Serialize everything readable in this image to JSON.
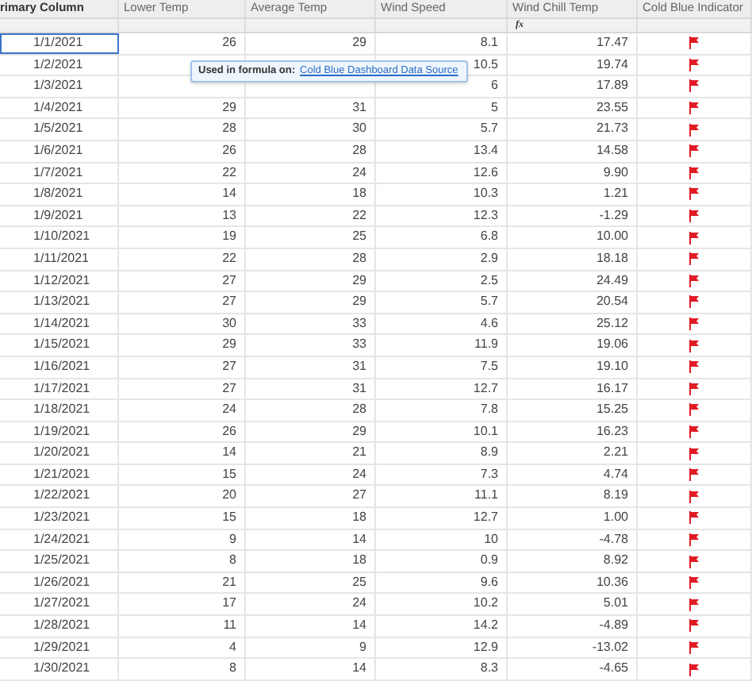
{
  "table": {
    "columns": [
      {
        "label": "rimary Column"
      },
      {
        "label": "Lower Temp"
      },
      {
        "label": "Average Temp"
      },
      {
        "label": "Wind Speed"
      },
      {
        "label": "Wind Chill Temp",
        "formula_mark": "fx"
      },
      {
        "label": "Cold Blue Indicator"
      }
    ],
    "rows": [
      {
        "date": "1/1/2021",
        "lower_temp": "26",
        "average_temp": "29",
        "wind_speed": "8.1",
        "wind_chill": "17.47",
        "flagged": true,
        "selected": true
      },
      {
        "date": "1/2/2021",
        "wind_speed": "10.5",
        "wind_chill": "19.74",
        "flagged": true,
        "selected": false
      },
      {
        "date": "1/3/2021",
        "wind_speed": "6",
        "wind_chill": "17.89",
        "flagged": true,
        "selected": false
      },
      {
        "date": "1/4/2021",
        "lower_temp": "29",
        "average_temp": "31",
        "wind_speed": "5",
        "wind_chill": "23.55",
        "flagged": true,
        "selected": false
      },
      {
        "date": "1/5/2021",
        "lower_temp": "28",
        "average_temp": "30",
        "wind_speed": "5.7",
        "wind_chill": "21.73",
        "flagged": true,
        "selected": false
      },
      {
        "date": "1/6/2021",
        "lower_temp": "26",
        "average_temp": "28",
        "wind_speed": "13.4",
        "wind_chill": "14.58",
        "flagged": true,
        "selected": false
      },
      {
        "date": "1/7/2021",
        "lower_temp": "22",
        "average_temp": "24",
        "wind_speed": "12.6",
        "wind_chill": "9.90",
        "flagged": true,
        "selected": false
      },
      {
        "date": "1/8/2021",
        "lower_temp": "14",
        "average_temp": "18",
        "wind_speed": "10.3",
        "wind_chill": "1.21",
        "flagged": true,
        "selected": false
      },
      {
        "date": "1/9/2021",
        "lower_temp": "13",
        "average_temp": "22",
        "wind_speed": "12.3",
        "wind_chill": "-1.29",
        "flagged": true,
        "selected": false
      },
      {
        "date": "1/10/2021",
        "lower_temp": "19",
        "average_temp": "25",
        "wind_speed": "6.8",
        "wind_chill": "10.00",
        "flagged": true,
        "selected": false
      },
      {
        "date": "1/11/2021",
        "lower_temp": "22",
        "average_temp": "28",
        "wind_speed": "2.9",
        "wind_chill": "18.18",
        "flagged": true,
        "selected": false
      },
      {
        "date": "1/12/2021",
        "lower_temp": "27",
        "average_temp": "29",
        "wind_speed": "2.5",
        "wind_chill": "24.49",
        "flagged": true,
        "selected": false
      },
      {
        "date": "1/13/2021",
        "lower_temp": "27",
        "average_temp": "29",
        "wind_speed": "5.7",
        "wind_chill": "20.54",
        "flagged": true,
        "selected": false
      },
      {
        "date": "1/14/2021",
        "lower_temp": "30",
        "average_temp": "33",
        "wind_speed": "4.6",
        "wind_chill": "25.12",
        "flagged": true,
        "selected": false
      },
      {
        "date": "1/15/2021",
        "lower_temp": "29",
        "average_temp": "33",
        "wind_speed": "11.9",
        "wind_chill": "19.06",
        "flagged": true,
        "selected": false
      },
      {
        "date": "1/16/2021",
        "lower_temp": "27",
        "average_temp": "31",
        "wind_speed": "7.5",
        "wind_chill": "19.10",
        "flagged": true,
        "selected": false
      },
      {
        "date": "1/17/2021",
        "lower_temp": "27",
        "average_temp": "31",
        "wind_speed": "12.7",
        "wind_chill": "16.17",
        "flagged": true,
        "selected": false
      },
      {
        "date": "1/18/2021",
        "lower_temp": "24",
        "average_temp": "28",
        "wind_speed": "7.8",
        "wind_chill": "15.25",
        "flagged": true,
        "selected": false
      },
      {
        "date": "1/19/2021",
        "lower_temp": "26",
        "average_temp": "29",
        "wind_speed": "10.1",
        "wind_chill": "16.23",
        "flagged": true,
        "selected": false
      },
      {
        "date": "1/20/2021",
        "lower_temp": "14",
        "average_temp": "21",
        "wind_speed": "8.9",
        "wind_chill": "2.21",
        "flagged": true,
        "selected": false
      },
      {
        "date": "1/21/2021",
        "lower_temp": "15",
        "average_temp": "24",
        "wind_speed": "7.3",
        "wind_chill": "4.74",
        "flagged": true,
        "selected": false
      },
      {
        "date": "1/22/2021",
        "lower_temp": "20",
        "average_temp": "27",
        "wind_speed": "11.1",
        "wind_chill": "8.19",
        "flagged": true,
        "selected": false
      },
      {
        "date": "1/23/2021",
        "lower_temp": "15",
        "average_temp": "18",
        "wind_speed": "12.7",
        "wind_chill": "1.00",
        "flagged": true,
        "selected": false
      },
      {
        "date": "1/24/2021",
        "lower_temp": "9",
        "average_temp": "14",
        "wind_speed": "10",
        "wind_chill": "-4.78",
        "flagged": true,
        "selected": false
      },
      {
        "date": "1/25/2021",
        "lower_temp": "8",
        "average_temp": "18",
        "wind_speed": "0.9",
        "wind_chill": "8.92",
        "flagged": true,
        "selected": false
      },
      {
        "date": "1/26/2021",
        "lower_temp": "21",
        "average_temp": "25",
        "wind_speed": "9.6",
        "wind_chill": "10.36",
        "flagged": true,
        "selected": false
      },
      {
        "date": "1/27/2021",
        "lower_temp": "17",
        "average_temp": "24",
        "wind_speed": "10.2",
        "wind_chill": "5.01",
        "flagged": true,
        "selected": false
      },
      {
        "date": "1/28/2021",
        "lower_temp": "11",
        "average_temp": "14",
        "wind_speed": "14.2",
        "wind_chill": "-4.89",
        "flagged": true,
        "selected": false
      },
      {
        "date": "1/29/2021",
        "lower_temp": "4",
        "average_temp": "9",
        "wind_speed": "12.9",
        "wind_chill": "-13.02",
        "flagged": true,
        "selected": false
      },
      {
        "date": "1/30/2021",
        "lower_temp": "8",
        "average_temp": "14",
        "wind_speed": "8.3",
        "wind_chill": "-4.65",
        "flagged": true,
        "selected": false
      }
    ]
  },
  "tooltip": {
    "label": "Used in formula on:",
    "link": "Cold Blue Dashboard Data Source"
  }
}
